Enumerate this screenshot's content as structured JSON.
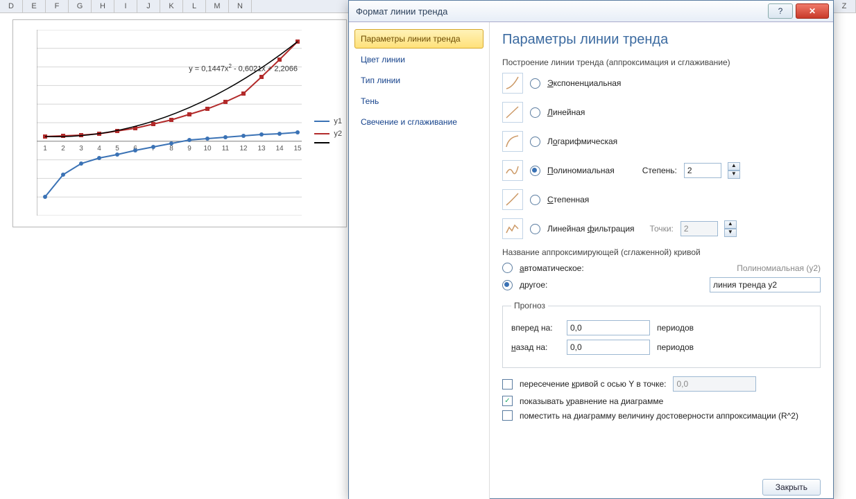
{
  "columns": [
    "D",
    "E",
    "F",
    "G",
    "H",
    "I",
    "J",
    "K",
    "L",
    "M",
    "N",
    "",
    "",
    "",
    "",
    "",
    "",
    "",
    "",
    "",
    "",
    "",
    "",
    "",
    "",
    "",
    "",
    "",
    "",
    "",
    "",
    "",
    "",
    "",
    "",
    "",
    "",
    "",
    "",
    "Z"
  ],
  "chart": {
    "equation_a": "y = 0,1447x",
    "equation_b": " - 0,6021x + 2,2066",
    "legend": {
      "y1": "y1",
      "y2": "y2"
    }
  },
  "chart_data": {
    "type": "line",
    "title": "",
    "xlabel": "",
    "ylabel": "",
    "ylim": [
      -20,
      30
    ],
    "yticks": [
      -20,
      -15,
      -10,
      -5,
      0,
      5,
      10,
      15,
      20,
      25,
      30
    ],
    "x": [
      1,
      2,
      3,
      4,
      5,
      6,
      7,
      8,
      9,
      10,
      11,
      12,
      13,
      14,
      15
    ],
    "series": [
      {
        "name": "y1",
        "color": "#3a72b5",
        "values": [
          -15,
          -9,
          -6,
          -4.5,
          -3.5,
          -2.5,
          -1.5,
          -0.5,
          0.3,
          0.8,
          1.2,
          1.5,
          1.8,
          2.1,
          2.4
        ]
      },
      {
        "name": "y2",
        "color": "#b22a2a",
        "values": [
          1.2,
          1.4,
          1.7,
          2.1,
          2.8,
          3.6,
          4.6,
          5.8,
          7.2,
          8.8,
          10.6,
          12.8,
          17.3,
          22.0,
          26.8
        ]
      }
    ],
    "trendline": {
      "series": "y2",
      "type": "polynomial",
      "degree": 2,
      "color": "#000",
      "equation": "y = 0,1447x² - 0,6021x + 2,2066"
    }
  },
  "dialog": {
    "title": "Формат линии тренда",
    "side": {
      "opt1": "Параметры линии тренда",
      "opt2": "Цвет линии",
      "opt3": "Тип линии",
      "opt4": "Тень",
      "opt5": "Свечение и сглаживание"
    },
    "heading": "Параметры линии тренда",
    "group1": "Построение линии тренда (аппроксимация и сглаживание)",
    "types": {
      "exp": "Экспоненциальная",
      "lin": "Линейная",
      "log": "Логарифмическая",
      "poly": "Полиномиальная",
      "pow": "Степенная",
      "mavg": "Линейная фильтрация"
    },
    "degree_label": "Степень:",
    "degree_value": "2",
    "points_label": "Точки:",
    "points_value": "2",
    "name_section": "Название аппроксимирующей (сглаженной) кривой",
    "name_auto": "автоматическое:",
    "name_auto_val": "Полиномиальная (y2)",
    "name_other": "другое:",
    "name_other_val": "линия тренда y2",
    "forecast": "Прогноз",
    "forward": "вперед на:",
    "backward": "назад на:",
    "fwd_val": "0,0",
    "bwd_val": "0,0",
    "periods": "периодов",
    "intercept": "пересечение кривой с осью Y в точке:",
    "intercept_val": "0,0",
    "show_eq": "показывать уравнение на диаграмме",
    "show_r2": "поместить на диаграмму величину достоверности аппроксимации (R^2)",
    "close": "Закрыть"
  }
}
